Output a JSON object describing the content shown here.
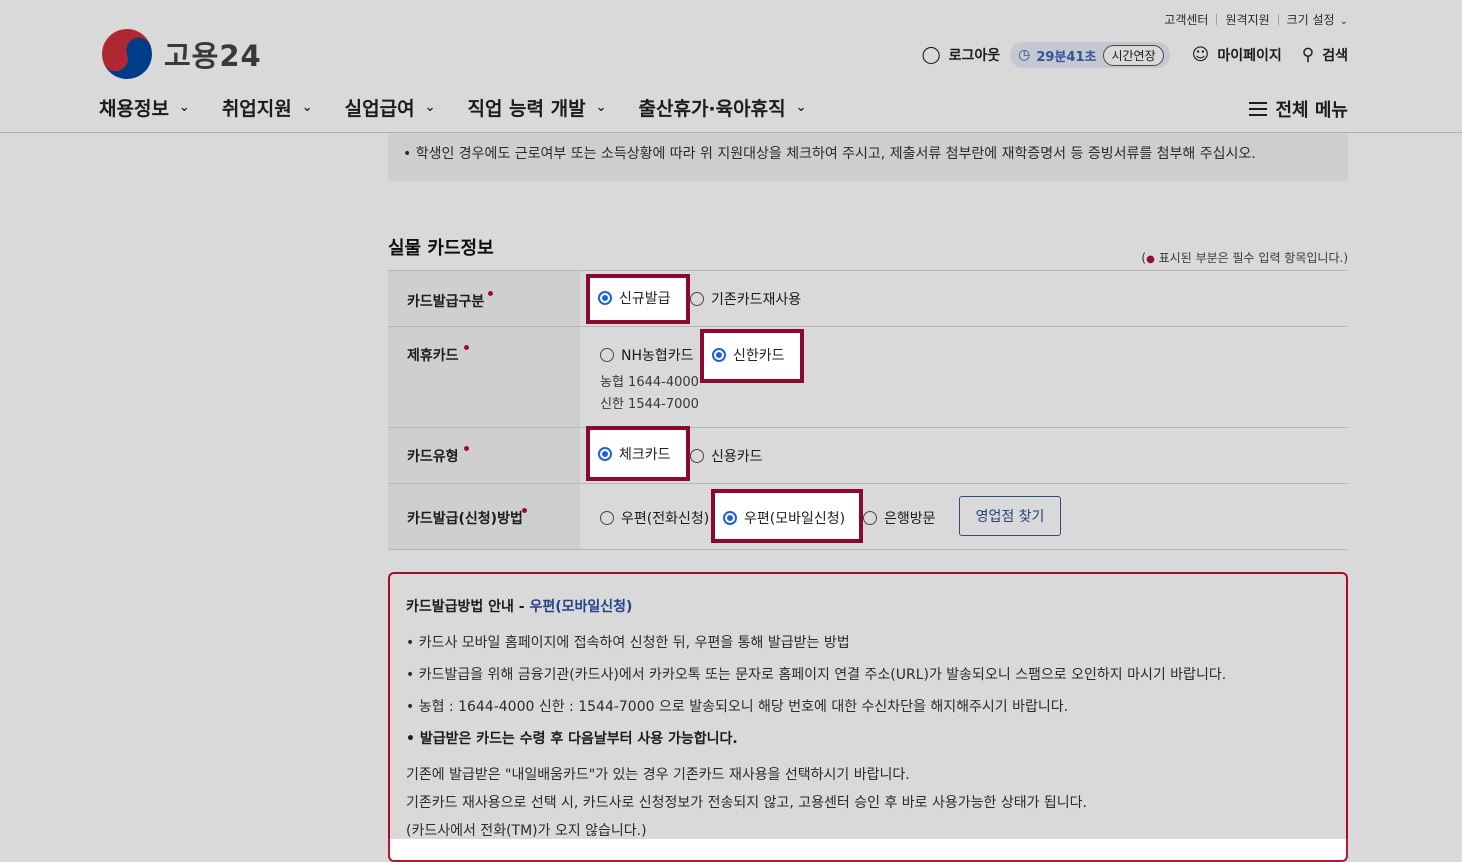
{
  "header": {
    "utility": [
      "고객센터",
      "원격지원",
      "크기 설정"
    ],
    "logo_text": "고용24",
    "logout_label": "로그아웃",
    "timer": "29분41초",
    "extend_label": "시간연장",
    "mypage_label": "마이페이지",
    "search_label": "검색",
    "gnb": [
      "채용정보",
      "취업지원",
      "실업급여",
      "직업 능력 개발",
      "출산휴가·육아휴직"
    ],
    "all_menu_label": "전체 메뉴"
  },
  "notice": "• 학생인 경우에도 근로여부 또는 소득상황에 따라 위 지원대상을 체크하여 주시고, 제출서류 첨부란에 재학증명서 등 증빙서류를 첨부해 주십시오.",
  "section": {
    "title": "실물 카드정보",
    "required_note_open": "(",
    "required_note": "표시된 부분은 필수 입력 항목입니다.)",
    "rows": {
      "issue_type": {
        "label": "카드발급구분",
        "options": [
          {
            "label": "신규발급",
            "selected": true
          },
          {
            "label": "기존카드재사용",
            "selected": false
          }
        ]
      },
      "partner_card": {
        "label": "제휴카드",
        "options": [
          {
            "label": "NH농협카드",
            "selected": false
          },
          {
            "label": "신한카드",
            "selected": true
          }
        ],
        "phone_nh": "농협 1644-4000",
        "phone_shinhan": "신한 1544-7000"
      },
      "card_type": {
        "label": "카드유형",
        "options": [
          {
            "label": "체크카드",
            "selected": true
          },
          {
            "label": "신용카드",
            "selected": false
          }
        ]
      },
      "issue_method": {
        "label": "카드발급(신청)방법",
        "options": [
          {
            "label": "우편(전화신청)",
            "selected": false
          },
          {
            "label": "우편(모바일신청)",
            "selected": true
          },
          {
            "label": "은행방문",
            "selected": false
          }
        ],
        "branch_button": "영업점 찾기"
      }
    }
  },
  "guide": {
    "title_prefix": "카드발급방법 안내 - ",
    "title_selected": "우편(모바일신청)",
    "bullets": [
      "• 카드사 모바일 홈페이지에 접속하여 신청한 뒤, 우편을 통해 발급받는 방법",
      "• 카드발급을 위해 금융기관(카드사)에서 카카오톡 또는 문자로 홈페이지 연결 주소(URL)가 발송되오니 스팸으로 오인하지 마시기 바랍니다.",
      "• 농협 : 1644-4000 신한 : 1544-7000 으로 발송되오니 해당 번호에 대한 수신차단을 해지해주시기 바랍니다.",
      "• 발급받은 카드는 수령 후 다음날부터 사용 가능합니다."
    ],
    "paragraphs": [
      "기존에 발급받은 \"내일배움카드\"가 있는 경우 기존카드 재사용을 선택하시기 바랍니다.",
      "기존카드 재사용으로 선택 시, 카드사로 신청정보가 전송되지 않고, 고용센터 승인 후 바로 사용가능한 상태가 됩니다.",
      "(카드사에서 전화(TM)가 오지 않습니다.)"
    ]
  },
  "colors": {
    "highlight_border": "#8a0a2c",
    "guide_border": "#c0112f",
    "radio_selected": "#1e63d6",
    "required_dot": "#b5103b"
  }
}
